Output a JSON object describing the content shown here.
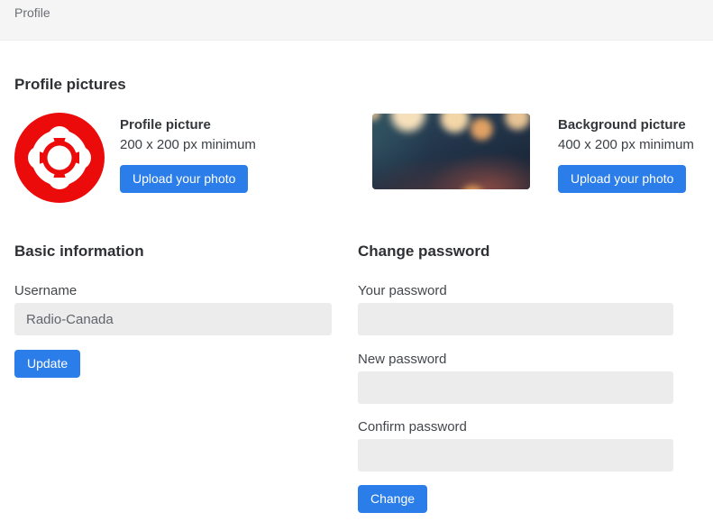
{
  "header": {
    "title": "Profile"
  },
  "profile_pictures": {
    "heading": "Profile pictures",
    "items": [
      {
        "name": "Profile picture",
        "requirement": "200 x 200 px minimum",
        "upload_button": "Upload your photo"
      },
      {
        "name": "Background picture",
        "requirement": "400 x 200 px minimum",
        "upload_button": "Upload your photo"
      }
    ]
  },
  "basic_information": {
    "heading": "Basic information",
    "username": {
      "label": "Username",
      "value": "Radio-Canada"
    },
    "update_button": "Update"
  },
  "change_password": {
    "heading": "Change password",
    "fields": [
      {
        "label": "Your password",
        "value": ""
      },
      {
        "label": "New password",
        "value": ""
      },
      {
        "label": "Confirm password",
        "value": ""
      }
    ],
    "change_button": "Change"
  },
  "colors": {
    "accent_blue": "#2b7de9",
    "logo_red": "#ec0b0b",
    "header_bg": "#f5f5f5",
    "input_bg": "#ececec"
  }
}
